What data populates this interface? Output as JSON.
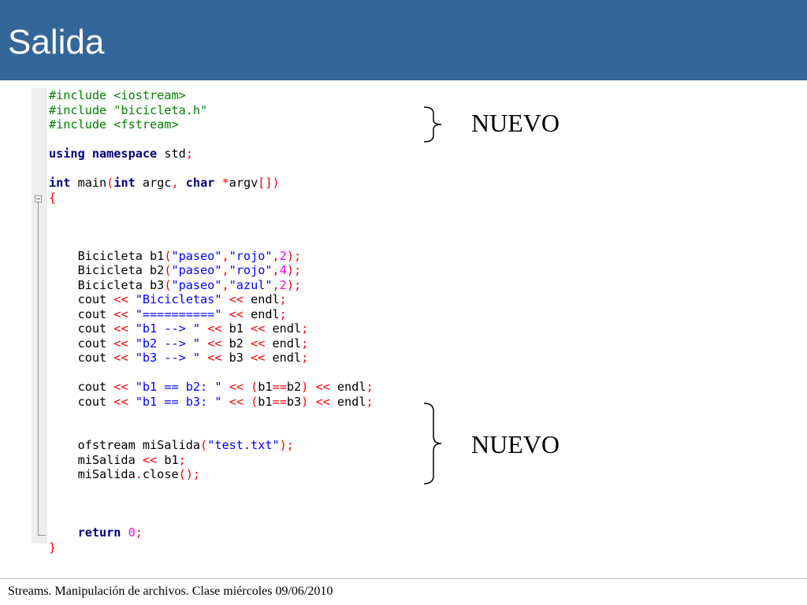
{
  "slide": {
    "title": "Salida",
    "footer": "Streams. Manipulación de archivos. Clase miércoles 09/06/2010"
  },
  "annotations": [
    {
      "label": "NUEVO"
    },
    {
      "label": "NUEVO"
    }
  ],
  "code": {
    "lines": [
      [
        {
          "t": "#include <iostream>",
          "c": "pp"
        }
      ],
      [
        {
          "t": "#include \"bicicleta.h\"",
          "c": "pp"
        }
      ],
      [
        {
          "t": "#include <fstream>",
          "c": "pp"
        }
      ],
      [],
      [
        {
          "t": "using namespace",
          "c": "kw"
        },
        {
          "t": " std"
        },
        {
          "t": ";",
          "c": "op"
        }
      ],
      [],
      [
        {
          "t": "int",
          "c": "kw"
        },
        {
          "t": " main"
        },
        {
          "t": "(",
          "c": "op"
        },
        {
          "t": "int",
          "c": "kw"
        },
        {
          "t": " argc"
        },
        {
          "t": ",",
          "c": "op"
        },
        {
          "t": " "
        },
        {
          "t": "char",
          "c": "kw"
        },
        {
          "t": " "
        },
        {
          "t": "*",
          "c": "op"
        },
        {
          "t": "argv"
        },
        {
          "t": "[])",
          "c": "op"
        }
      ],
      [
        {
          "t": "{",
          "c": "op"
        }
      ],
      [],
      [],
      [],
      [
        {
          "t": "    Bicicleta b1"
        },
        {
          "t": "(",
          "c": "op"
        },
        {
          "t": "\"paseo\"",
          "c": "str"
        },
        {
          "t": ",",
          "c": "op"
        },
        {
          "t": "\"rojo\"",
          "c": "str"
        },
        {
          "t": ",",
          "c": "op"
        },
        {
          "t": "2",
          "c": "num"
        },
        {
          "t": ");",
          "c": "op"
        }
      ],
      [
        {
          "t": "    Bicicleta b2"
        },
        {
          "t": "(",
          "c": "op"
        },
        {
          "t": "\"paseo\"",
          "c": "str"
        },
        {
          "t": ",",
          "c": "op"
        },
        {
          "t": "\"rojo\"",
          "c": "str"
        },
        {
          "t": ",",
          "c": "op"
        },
        {
          "t": "4",
          "c": "num"
        },
        {
          "t": ");",
          "c": "op"
        }
      ],
      [
        {
          "t": "    Bicicleta b3"
        },
        {
          "t": "(",
          "c": "op"
        },
        {
          "t": "\"paseo\"",
          "c": "str"
        },
        {
          "t": ",",
          "c": "op"
        },
        {
          "t": "\"azul\"",
          "c": "str"
        },
        {
          "t": ",",
          "c": "op"
        },
        {
          "t": "2",
          "c": "num"
        },
        {
          "t": ");",
          "c": "op"
        }
      ],
      [
        {
          "t": "    cout "
        },
        {
          "t": "<<",
          "c": "op"
        },
        {
          "t": " "
        },
        {
          "t": "\"Bicicletas\"",
          "c": "str"
        },
        {
          "t": " "
        },
        {
          "t": "<<",
          "c": "op"
        },
        {
          "t": " endl"
        },
        {
          "t": ";",
          "c": "op"
        }
      ],
      [
        {
          "t": "    cout "
        },
        {
          "t": "<<",
          "c": "op"
        },
        {
          "t": " "
        },
        {
          "t": "\"==========\"",
          "c": "str"
        },
        {
          "t": " "
        },
        {
          "t": "<<",
          "c": "op"
        },
        {
          "t": " endl"
        },
        {
          "t": ";",
          "c": "op"
        }
      ],
      [
        {
          "t": "    cout "
        },
        {
          "t": "<<",
          "c": "op"
        },
        {
          "t": " "
        },
        {
          "t": "\"b1 --> \"",
          "c": "str"
        },
        {
          "t": " "
        },
        {
          "t": "<<",
          "c": "op"
        },
        {
          "t": " b1 "
        },
        {
          "t": "<<",
          "c": "op"
        },
        {
          "t": " endl"
        },
        {
          "t": ";",
          "c": "op"
        }
      ],
      [
        {
          "t": "    cout "
        },
        {
          "t": "<<",
          "c": "op"
        },
        {
          "t": " "
        },
        {
          "t": "\"b2 --> \"",
          "c": "str"
        },
        {
          "t": " "
        },
        {
          "t": "<<",
          "c": "op"
        },
        {
          "t": " b2 "
        },
        {
          "t": "<<",
          "c": "op"
        },
        {
          "t": " endl"
        },
        {
          "t": ";",
          "c": "op"
        }
      ],
      [
        {
          "t": "    cout "
        },
        {
          "t": "<<",
          "c": "op"
        },
        {
          "t": " "
        },
        {
          "t": "\"b3 --> \"",
          "c": "str"
        },
        {
          "t": " "
        },
        {
          "t": "<<",
          "c": "op"
        },
        {
          "t": " b3 "
        },
        {
          "t": "<<",
          "c": "op"
        },
        {
          "t": " endl"
        },
        {
          "t": ";",
          "c": "op"
        }
      ],
      [],
      [
        {
          "t": "    cout "
        },
        {
          "t": "<<",
          "c": "op"
        },
        {
          "t": " "
        },
        {
          "t": "\"b1 == b2: \"",
          "c": "str"
        },
        {
          "t": " "
        },
        {
          "t": "<<",
          "c": "op"
        },
        {
          "t": " "
        },
        {
          "t": "(",
          "c": "op"
        },
        {
          "t": "b1"
        },
        {
          "t": "==",
          "c": "op"
        },
        {
          "t": "b2"
        },
        {
          "t": ")",
          "c": "op"
        },
        {
          "t": " "
        },
        {
          "t": "<<",
          "c": "op"
        },
        {
          "t": " endl"
        },
        {
          "t": ";",
          "c": "op"
        }
      ],
      [
        {
          "t": "    cout "
        },
        {
          "t": "<<",
          "c": "op"
        },
        {
          "t": " "
        },
        {
          "t": "\"b1 == b3: \"",
          "c": "str"
        },
        {
          "t": " "
        },
        {
          "t": "<<",
          "c": "op"
        },
        {
          "t": " "
        },
        {
          "t": "(",
          "c": "op"
        },
        {
          "t": "b1"
        },
        {
          "t": "==",
          "c": "op"
        },
        {
          "t": "b3"
        },
        {
          "t": ")",
          "c": "op"
        },
        {
          "t": " "
        },
        {
          "t": "<<",
          "c": "op"
        },
        {
          "t": " endl"
        },
        {
          "t": ";",
          "c": "op"
        }
      ],
      [],
      [],
      [
        {
          "t": "    ofstream miSalida"
        },
        {
          "t": "(",
          "c": "op"
        },
        {
          "t": "\"test.txt\"",
          "c": "str"
        },
        {
          "t": ");",
          "c": "op"
        }
      ],
      [
        {
          "t": "    miSalida "
        },
        {
          "t": "<<",
          "c": "op"
        },
        {
          "t": " b1"
        },
        {
          "t": ";",
          "c": "op"
        }
      ],
      [
        {
          "t": "    miSalida"
        },
        {
          "t": ".",
          "c": "op"
        },
        {
          "t": "close"
        },
        {
          "t": "();",
          "c": "op"
        }
      ],
      [],
      [],
      [],
      [
        {
          "t": "    "
        },
        {
          "t": "return",
          "c": "kw"
        },
        {
          "t": " "
        },
        {
          "t": "0",
          "c": "num"
        },
        {
          "t": ";",
          "c": "op"
        }
      ],
      [
        {
          "t": "}",
          "c": "op"
        }
      ]
    ]
  }
}
